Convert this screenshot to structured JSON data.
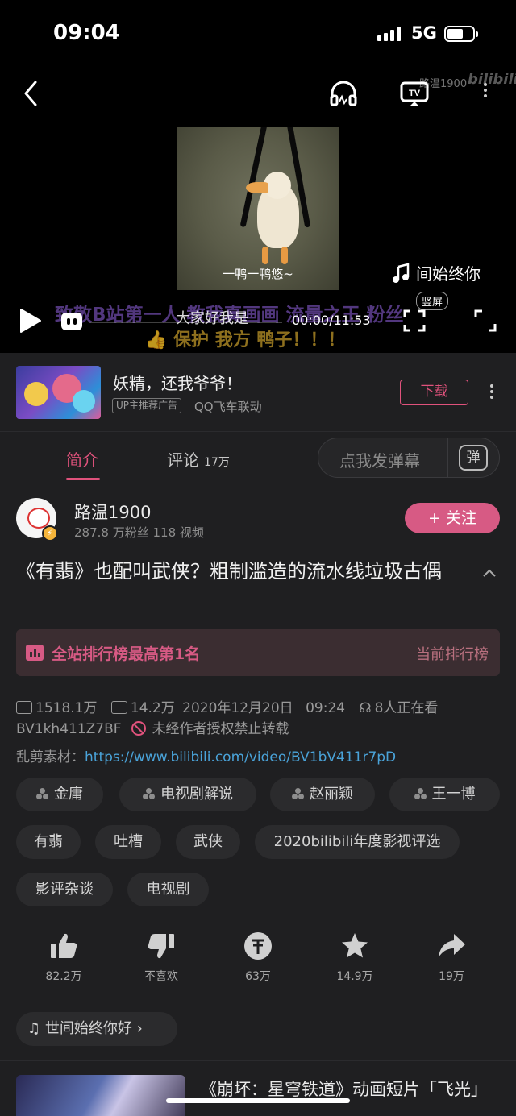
{
  "status_bar": {
    "time": "09:04",
    "network": "5G"
  },
  "player": {
    "watermark_user": "路温1900",
    "watermark_logo": "bilibili",
    "frame_caption": "一鸭一鸭悠~",
    "danmaku": [
      "致敬B站第一人 教我真画画 流量之王 粉丝",
      "👍 保护 我方 鸭子！！！",
      "大家好我是"
    ],
    "music_tag": "间始终你",
    "timecode": "00:00/11:53",
    "vertical_label": "竖屏",
    "progress_fraction": 0
  },
  "ad": {
    "title": "妖精，还我爷爷！",
    "badge": "UP主推荐广告",
    "sponsor": "QQ飞车联动",
    "download_label": "下载"
  },
  "tabs": {
    "intro": "简介",
    "comments": "评论",
    "comments_count": "17万",
    "danmaku_placeholder": "点我发弹幕",
    "danmaku_button": "弹"
  },
  "uploader": {
    "name": "路温1900",
    "stats": "287.8 万粉丝  118 视频",
    "follow_label": "+ 关注"
  },
  "video": {
    "title": "《有翡》也配叫武侠？粗制滥造的流水线垃圾古偶"
  },
  "rank": {
    "text": "全站排行榜最高第1名",
    "link": "当前排行榜"
  },
  "meta": {
    "views": "1518.1万",
    "danmaku_count": "14.2万",
    "date": "2020年12月20日",
    "time": "09:24",
    "watching": "8人正在看",
    "bvid": "BV1kh411Z7BF",
    "copyright": "未经作者授权禁止转载",
    "source_label": "乱剪素材：",
    "source_url": "https://www.bilibili.com/video/BV1bV411r7pD"
  },
  "tags": [
    "金庸",
    "电视剧解说",
    "赵丽颖",
    "王一博",
    "有翡",
    "吐槽",
    "武侠",
    "2020bilibili年度影视评选",
    "影评杂谈",
    "电视剧"
  ],
  "actions": {
    "like": "82.2万",
    "dislike": "不喜欢",
    "coin": "63万",
    "favorite": "14.9万",
    "share": "19万"
  },
  "song": "世间始终你好",
  "recommendation": {
    "title": "《崩坏：星穹铁道》动画短片「飞光」"
  },
  "colors": {
    "accent": "#e0527c",
    "background": "#1f1f21",
    "link": "#4aa3d9"
  }
}
